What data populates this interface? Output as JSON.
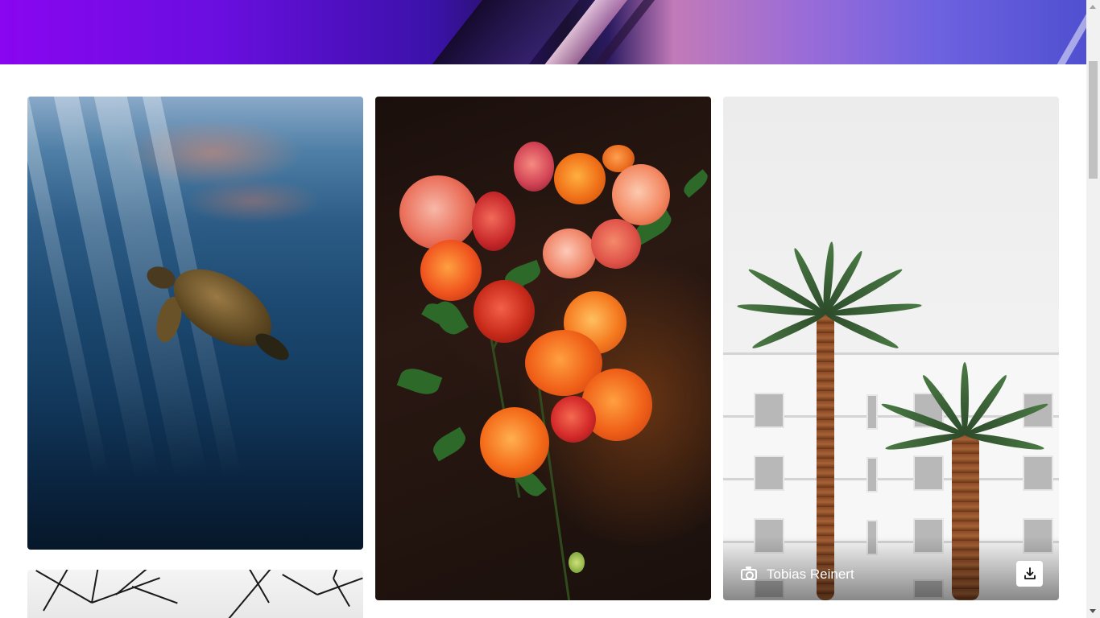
{
  "gallery": {
    "photos": [
      {
        "subject": "sea-turtle"
      },
      {
        "subject": "dahlia-bouquet"
      },
      {
        "subject": "palm-trees-hotel",
        "photographer": "Tobias Reinert",
        "download_icon": "download-icon",
        "camera_icon": "camera-icon"
      },
      {
        "subject": "palm-fronds-bw"
      }
    ]
  },
  "colors": {
    "hero_start": "#8a06f0",
    "hero_end": "#5050d0",
    "background": "#ffffff"
  }
}
